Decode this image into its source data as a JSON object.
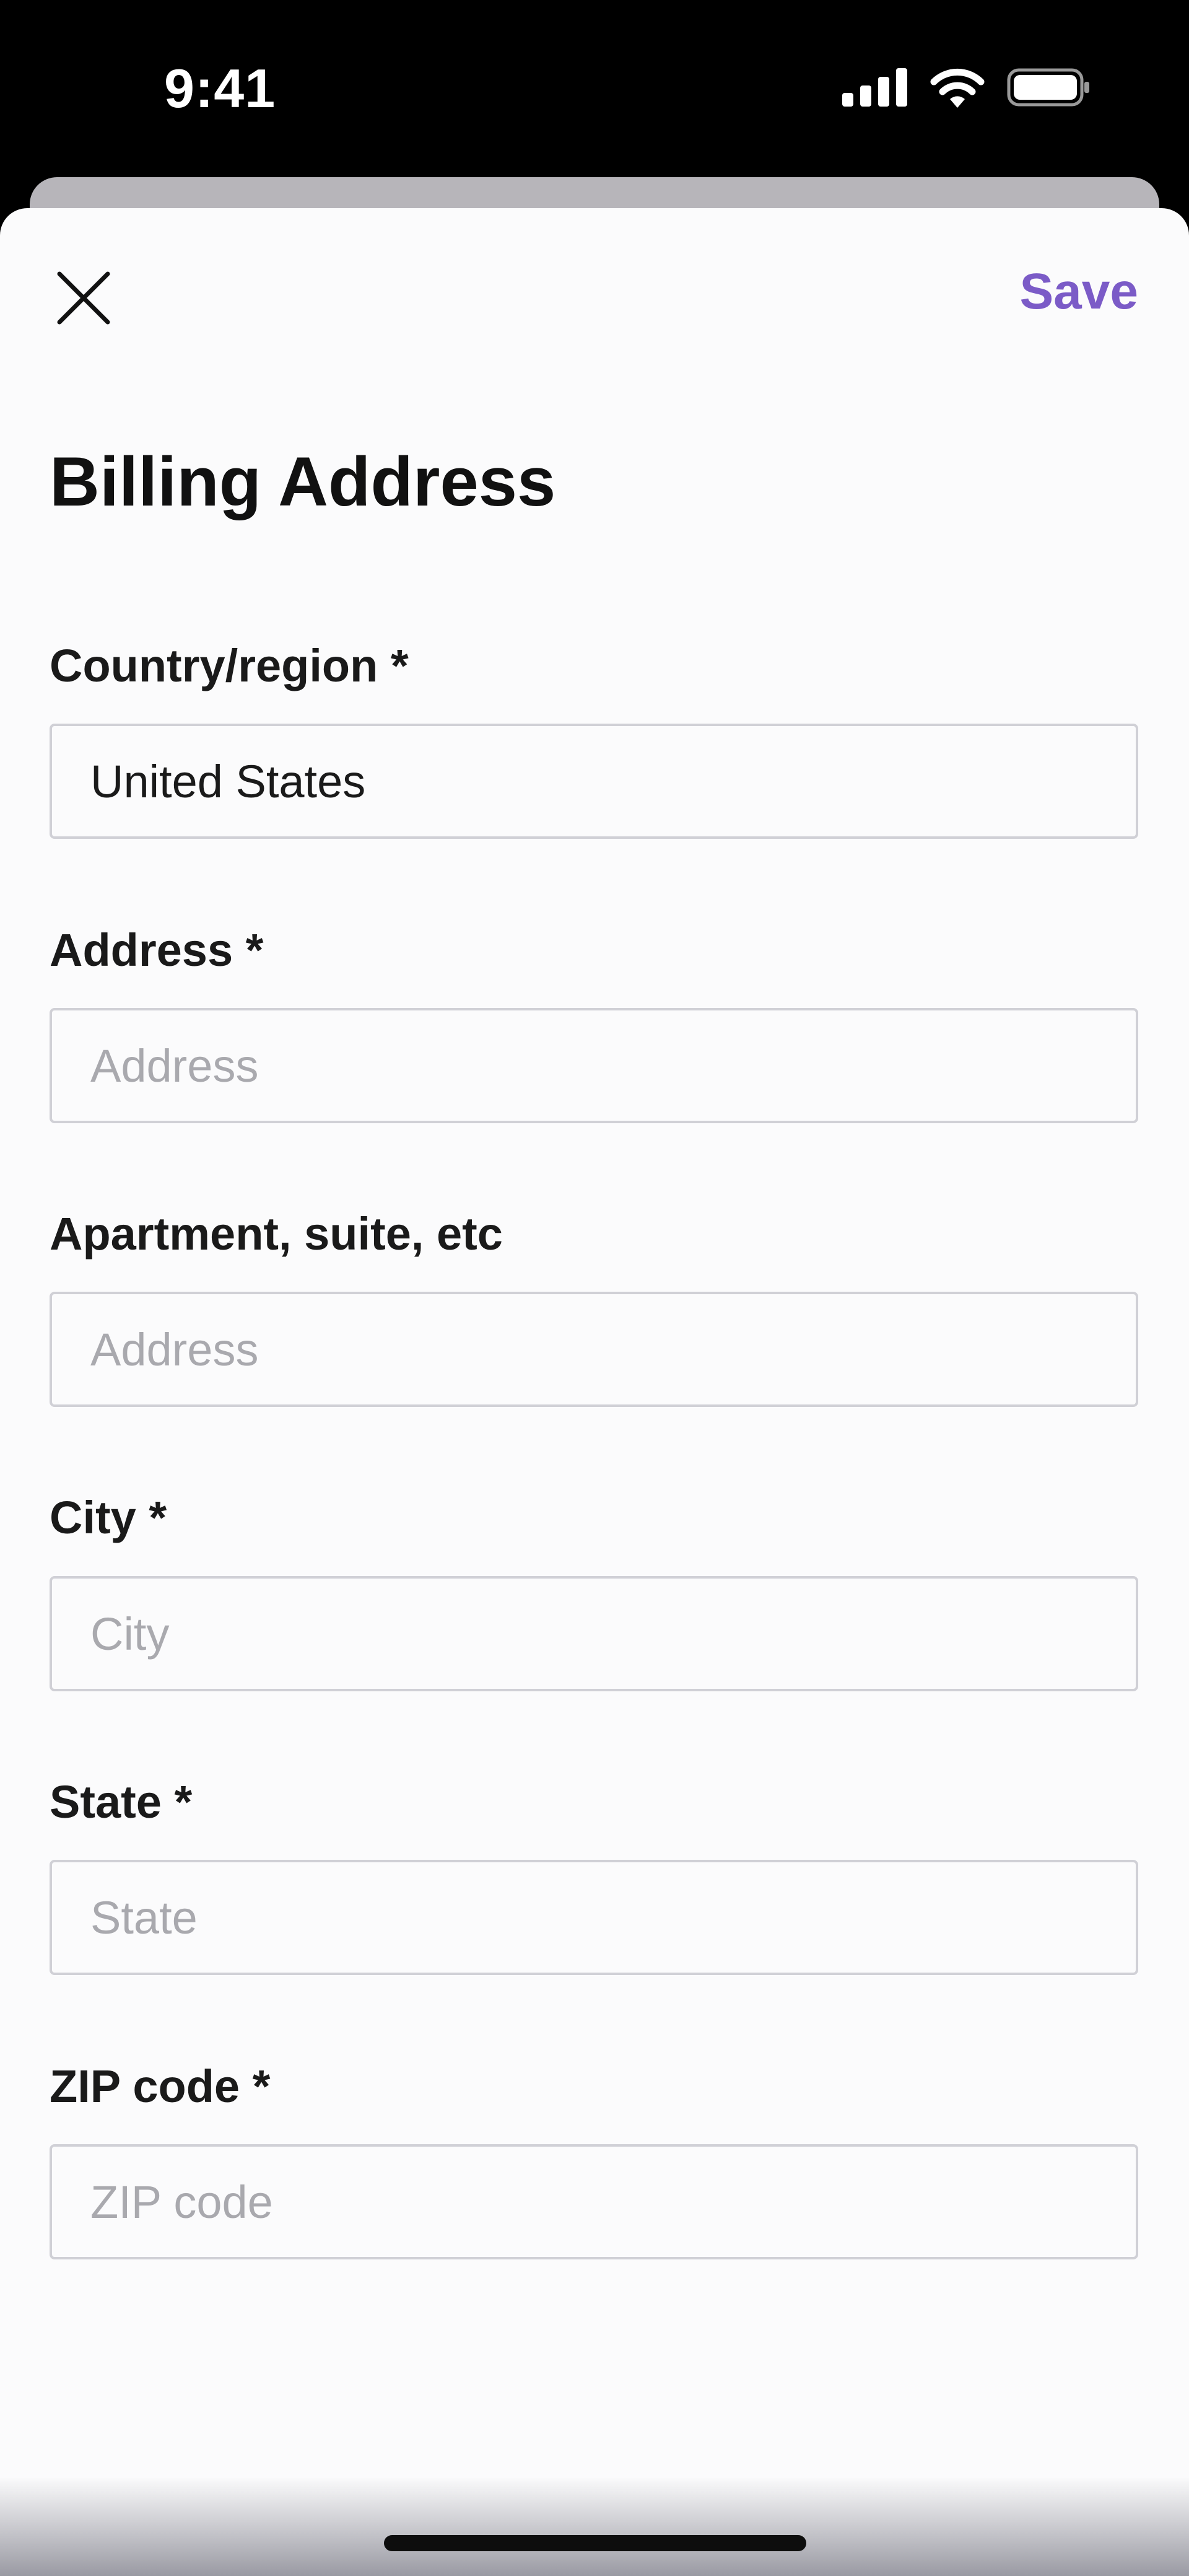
{
  "status_bar": {
    "time": "9:41",
    "icons": [
      "cellular-signal-icon",
      "wifi-icon",
      "battery-icon"
    ]
  },
  "header": {
    "close_icon": "close-icon",
    "save_label": "Save",
    "title": "Billing Address"
  },
  "colors": {
    "accent": "#7b5bc7",
    "background": "#fbfbfc",
    "border": "#d0d0d6",
    "placeholder": "#a9a9ae"
  },
  "form": {
    "country": {
      "label": "Country/region *",
      "value": "United States",
      "placeholder": ""
    },
    "address": {
      "label": "Address *",
      "value": "",
      "placeholder": "Address"
    },
    "apartment": {
      "label": "Apartment, suite, etc",
      "value": "",
      "placeholder": "Address"
    },
    "city": {
      "label": "City *",
      "value": "",
      "placeholder": "City"
    },
    "state": {
      "label": "State *",
      "value": "",
      "placeholder": "State"
    },
    "zip": {
      "label": "ZIP code *",
      "value": "",
      "placeholder": "ZIP code"
    }
  }
}
